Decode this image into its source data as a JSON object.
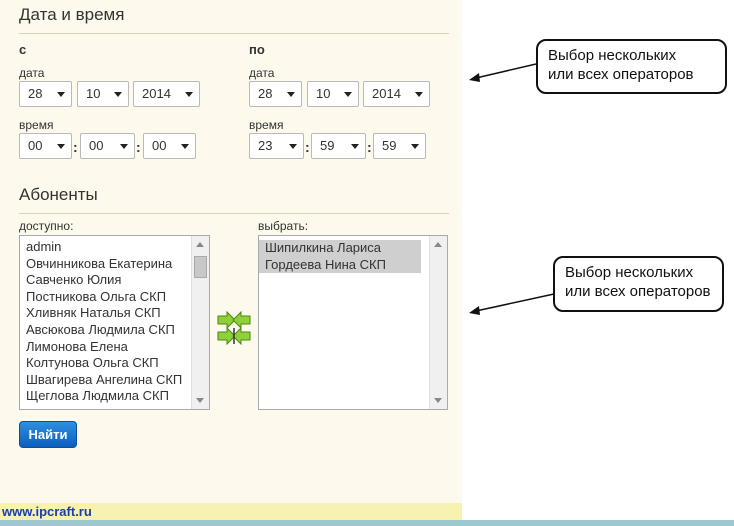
{
  "section_datetime": {
    "title": "Дата и время"
  },
  "from": {
    "label": "с",
    "date_label": "дата",
    "day": "28",
    "month": "10",
    "year": "2014",
    "time_label": "время",
    "hour": "00",
    "minute": "00",
    "second": "00"
  },
  "to": {
    "label": "по",
    "date_label": "дата",
    "day": "28",
    "month": "10",
    "year": "2014",
    "time_label": "время",
    "hour": "23",
    "minute": "59",
    "second": "59"
  },
  "time_separator": ":",
  "section_subscribers": {
    "title": "Абоненты"
  },
  "available": {
    "label": "доступно:",
    "items": [
      "admin",
      "Овчинникова Екатерина",
      "Савченко Юлия",
      "Постникова Ольга СКП",
      "Хливняк Наталья СКП",
      "Авсюкова Людмила СКП",
      "Лимонова Елена",
      "Колтунова Ольга СКП",
      "Швагирева Ангелина СКП",
      "Щеглова Людмила СКП"
    ]
  },
  "selected": {
    "label": "выбрать:",
    "items": [
      "Шипилкина Лариса",
      "Гордеева Нина СКП"
    ]
  },
  "submit_label": "Найти",
  "callouts": {
    "top": "Выбор нескольких\nили всех операторов",
    "bottom": "Выбор нескольких\nили всех операторов"
  },
  "footer": {
    "site": "www.ipcraft.ru"
  },
  "colors": {
    "panel_bg": "#fdf9ec",
    "button": "#1a6fcf",
    "footer_bar": "#f7f1b2",
    "link": "#1a3db0"
  },
  "icons": {
    "transfer": "transfer-arrows-icon"
  }
}
